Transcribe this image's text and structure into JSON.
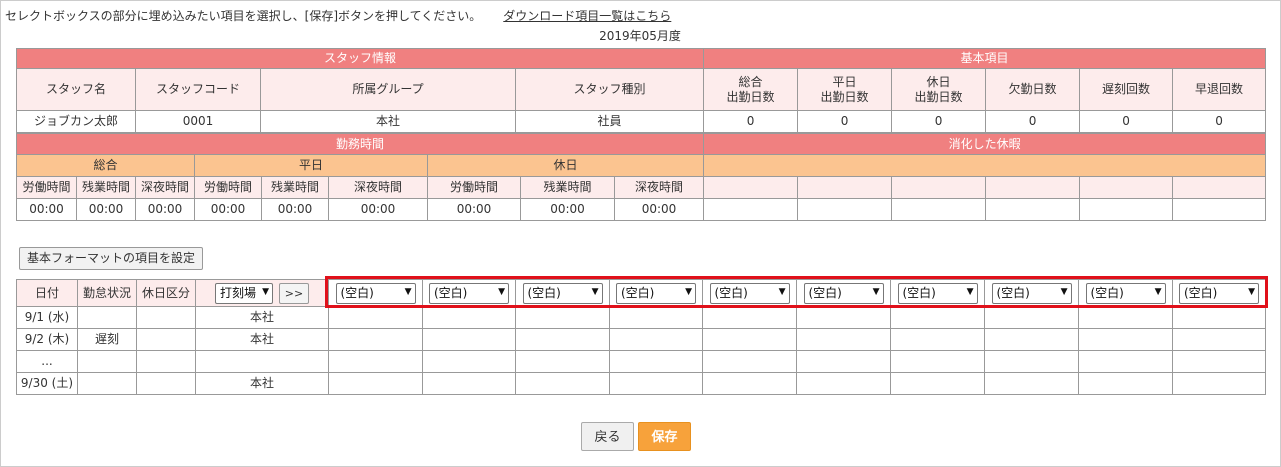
{
  "intro": {
    "text": "セレクトボックスの部分に埋め込みたい項目を選択し、[保存]ボタンを押してください。",
    "link": "ダウンロード項目一覧はこちら"
  },
  "period": "2019年05月度",
  "staff_section": {
    "title": "スタッフ情報",
    "headers": [
      "スタッフ名",
      "スタッフコード",
      "所属グループ",
      "スタッフ種別"
    ],
    "values": [
      "ジョブカン太郎",
      "0001",
      "本社",
      "社員"
    ]
  },
  "basic_section": {
    "title": "基本項目",
    "headers": [
      {
        "line1": "総合",
        "line2": "出勤日数"
      },
      {
        "line1": "平日",
        "line2": "出勤日数"
      },
      {
        "line1": "休日",
        "line2": "出勤日数"
      },
      {
        "line1": "欠勤日数",
        "line2": ""
      },
      {
        "line1": "遅刻回数",
        "line2": ""
      },
      {
        "line1": "早退回数",
        "line2": ""
      }
    ],
    "values": [
      "0",
      "0",
      "0",
      "0",
      "0",
      "0"
    ]
  },
  "work_section": {
    "title": "勤務時間",
    "groups": [
      "総合",
      "平日",
      "休日"
    ],
    "headers": [
      "労働時間",
      "残業時間",
      "深夜時間",
      "労働時間",
      "残業時間",
      "深夜時間",
      "労働時間",
      "残業時間",
      "深夜時間"
    ],
    "values": [
      "00:00",
      "00:00",
      "00:00",
      "00:00",
      "00:00",
      "00:00",
      "00:00",
      "00:00",
      "00:00"
    ]
  },
  "leave_section": {
    "title": "消化した休暇"
  },
  "set_format_button": "基本フォーマットの項目を設定",
  "daily": {
    "headers": [
      "日付",
      "勤怠状況",
      "休日区分"
    ],
    "stamp_select": "打刻場",
    "arrow_button": ">>",
    "blank_select": "(空白)",
    "rows": [
      {
        "date": "9/1 (水)",
        "status": "",
        "holiday": "",
        "place": "本社"
      },
      {
        "date": "9/2 (木)",
        "status": "遅刻",
        "holiday": "",
        "place": "本社"
      },
      {
        "date": "...",
        "status": "",
        "holiday": "",
        "place": ""
      },
      {
        "date": "9/30 (土)",
        "status": "",
        "holiday": "",
        "place": "本社"
      }
    ]
  },
  "footer": {
    "back_label": "戻る",
    "save_label": "保存"
  },
  "colors": {
    "section_red": "#f08080",
    "section_orange": "#fbc490",
    "header_pink": "#fdecec",
    "highlight": "#e0101a",
    "save_button": "#f7a23b"
  }
}
